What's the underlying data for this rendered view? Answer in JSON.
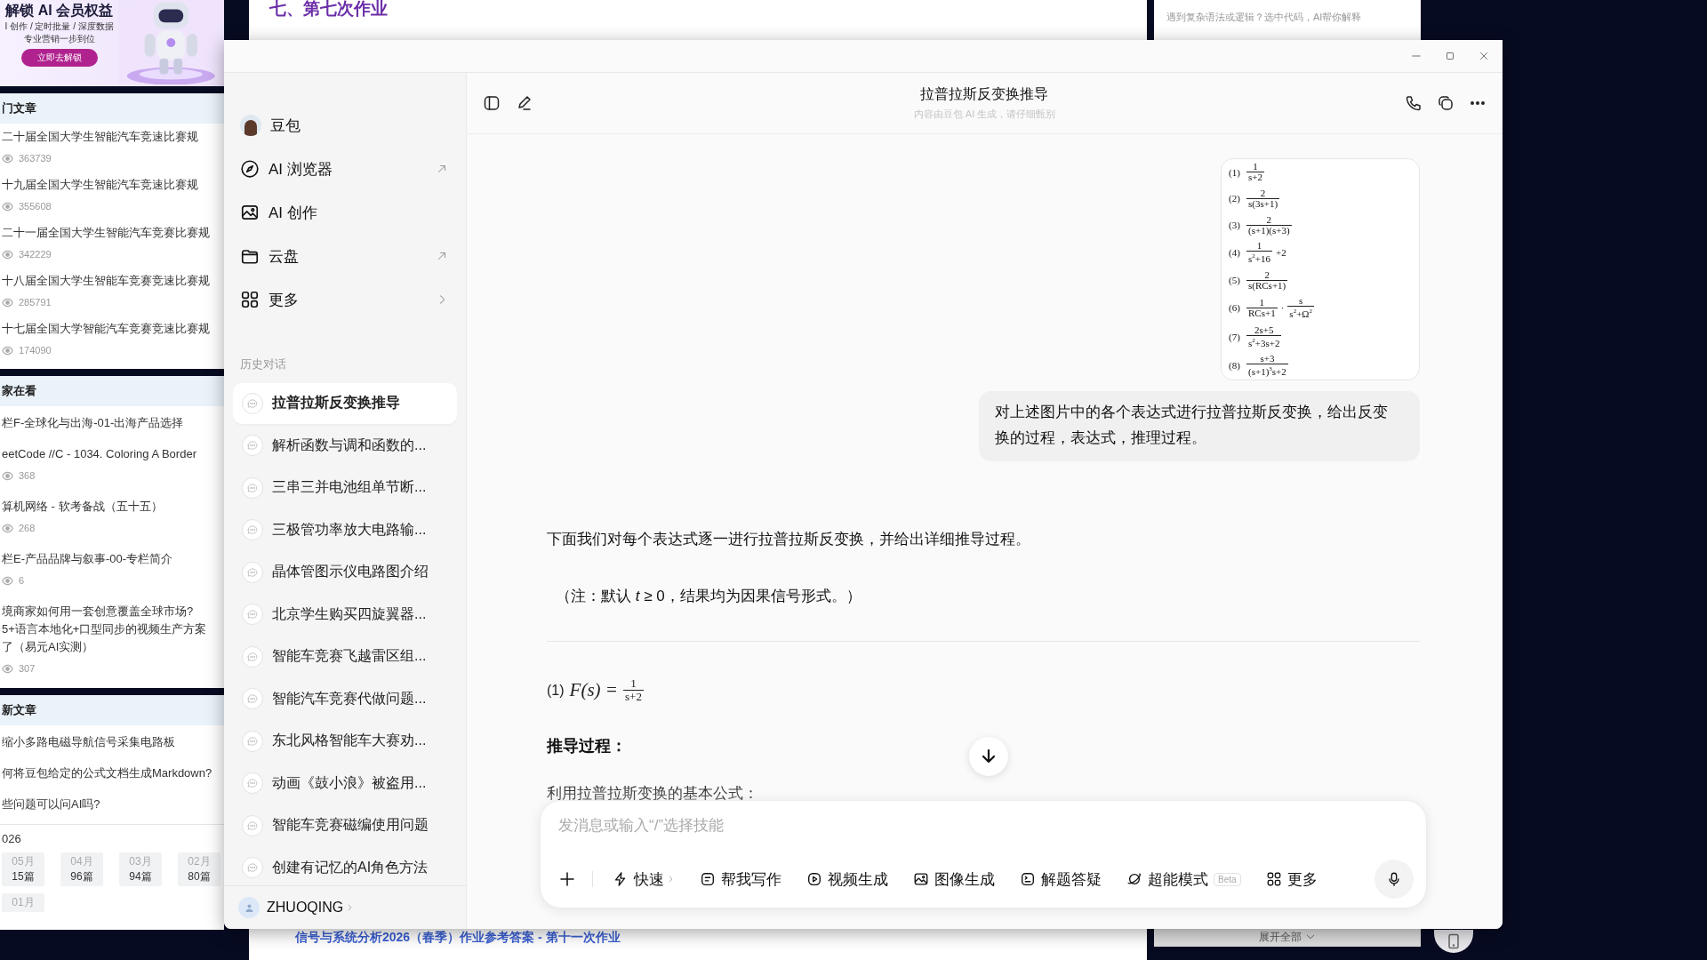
{
  "background_page": {
    "left_panel": {
      "banner": {
        "title": "解锁 AI 会员权益",
        "lines": [
          "I 创作 / 定时批量 / 深度数据",
          "专业营销一步到位"
        ],
        "button": "立即去解锁"
      },
      "sections": [
        {
          "title": "门文章",
          "items": [
            {
              "title": "二十届全国大学生智能汽车竞速比赛规",
              "views": "363739"
            },
            {
              "title": "十九届全国大学生智能汽车竞速比赛规",
              "views": "355608"
            },
            {
              "title": "二十一届全国大学生智能汽车竞赛比赛规",
              "views": "342229"
            },
            {
              "title": "十八届全国大学生智能车竞赛竞速比赛规",
              "views": "285791"
            },
            {
              "title": "十七届全国大学智能汽车竞赛竞速比赛规",
              "views": "174090"
            }
          ]
        },
        {
          "title": "家在看",
          "items": [
            {
              "title": "栏F-全球化与出海-01-出海产品选择"
            },
            {
              "title": "eetCode //C - 1034. Coloring A Border",
              "views": "368"
            },
            {
              "title": "算机网络 - 软考备战（五十五）",
              "views": "268"
            },
            {
              "title": "栏E-产品品牌与叙事-00-专栏简介",
              "views": "6"
            },
            {
              "title": "境商家如何用一套创意覆盖全球市场?5+语言本地化+口型同步的视频生产方案了（易元AI实测）",
              "views": "307"
            }
          ]
        },
        {
          "title": "新文章",
          "items": [
            {
              "title": "缩小多路电磁导航信号采集电路板"
            },
            {
              "title": "何将豆包给定的公式文档生成Markdown?"
            },
            {
              "title": "些问题可以问AI吗?"
            }
          ]
        }
      ],
      "archive": {
        "year": "026",
        "months": [
          {
            "month": "05月",
            "count": "15篇"
          },
          {
            "month": "04月",
            "count": "96篇"
          },
          {
            "month": "03月",
            "count": "94篇"
          },
          {
            "month": "02月",
            "count": "80篇"
          },
          {
            "month": "01月"
          }
        ]
      }
    },
    "center": {
      "heading": "七、第七次作业",
      "bottom_link": "信号与系统分析2026（春季）作业参考答案 - 第十一次作业"
    },
    "right_panel": {
      "tip": "遇到复杂语法或逻辑？选中代码，AI帮你解释",
      "expand": "展开全部"
    }
  },
  "window": {
    "sidebar": {
      "nav": [
        {
          "label": "豆包",
          "kind": "avatar"
        },
        {
          "label": "AI 浏览器",
          "kind": "external"
        },
        {
          "label": "AI 创作",
          "kind": "plain"
        },
        {
          "label": "云盘",
          "kind": "external"
        },
        {
          "label": "更多",
          "kind": "submenu"
        }
      ],
      "history_title": "历史对话",
      "history": [
        {
          "label": "拉普拉斯反变换推导",
          "selected": true
        },
        {
          "label": "解析函数与调和函数的...",
          "selected": false
        },
        {
          "label": "三串三并电池组单节断...",
          "selected": false
        },
        {
          "label": "三极管功率放大电路输...",
          "selected": false
        },
        {
          "label": "晶体管图示仪电路图介绍",
          "selected": false
        },
        {
          "label": "北京学生购买四旋翼器...",
          "selected": false
        },
        {
          "label": "智能车竞赛飞越雷区组...",
          "selected": false
        },
        {
          "label": "智能汽车竞赛代做问题...",
          "selected": false
        },
        {
          "label": "东北风格智能车大赛劝...",
          "selected": false
        },
        {
          "label": "动画《鼓小浪》被盗用...",
          "selected": false
        },
        {
          "label": "智能车竞赛磁编使用问题",
          "selected": false
        },
        {
          "label": "创建有记忆的AI角色方法",
          "selected": false
        }
      ],
      "user": "ZHUOQING"
    },
    "header": {
      "title": "拉普拉斯反变换推导",
      "subtitle": "内容由豆包 AI 生成，请仔细甄别"
    },
    "conversation": {
      "image": {
        "formulas": [
          {
            "label": "(1)",
            "parts": [
              {
                "kind": "frac",
                "num": "1",
                "den": "s+2"
              }
            ]
          },
          {
            "label": "(2)",
            "parts": [
              {
                "kind": "frac",
                "num": "2",
                "den": "s(3s+1)"
              }
            ]
          },
          {
            "label": "(3)",
            "parts": [
              {
                "kind": "frac",
                "num": "2",
                "den": "(s+1)(s+3)"
              }
            ]
          },
          {
            "label": "(4)",
            "parts": [
              {
                "kind": "frac",
                "num": "1",
                "den": "s$^{2}$+16"
              },
              {
                "kind": "text",
                "text": "+2"
              }
            ]
          },
          {
            "label": "(5)",
            "parts": [
              {
                "kind": "frac",
                "num": "2",
                "den": "s(RCs+1)"
              }
            ]
          },
          {
            "label": "(6)",
            "parts": [
              {
                "kind": "frac",
                "num": "1",
                "den": "RCs+1"
              },
              {
                "kind": "text",
                "text": "·"
              },
              {
                "kind": "frac",
                "num": "s",
                "den": "s$^{2}$+Ω$^{2}$"
              }
            ]
          },
          {
            "label": "(7)",
            "parts": [
              {
                "kind": "frac",
                "num": "2s+5",
                "den": "s$^{2}$+3s+2"
              }
            ]
          },
          {
            "label": "(8)",
            "parts": [
              {
                "kind": "frac",
                "num": "s+3",
                "den": "(s+1)$^{3}$s+2"
              }
            ]
          }
        ]
      },
      "user_message": "对上述图片中的各个表达式进行拉普拉斯反变换，给出反变换的过程，表达式，推理过程。",
      "reply": [
        {
          "kind": "paragraph",
          "text": "下面我们对每个表达式逐一进行拉普拉斯反变换，并给出详细推导过程。"
        },
        {
          "kind": "note",
          "text": "（注：默认 *t* ≥ 0，结果均为因果信号形式。）"
        },
        {
          "kind": "divider"
        },
        {
          "kind": "formula",
          "label": "(1)",
          "lhs": "F(s) =",
          "num": "1",
          "den": "s+2"
        },
        {
          "kind": "heading",
          "text": "推导过程："
        },
        {
          "kind": "paragraph",
          "text": "利用拉普拉斯变换的基本公式："
        }
      ]
    },
    "composer": {
      "placeholder": "发消息或输入“/”选择技能",
      "tools": [
        {
          "label": "快速",
          "kind": "dropdown"
        },
        {
          "label": "帮我写作",
          "kind": "skill"
        },
        {
          "label": "视频生成",
          "kind": "skill"
        },
        {
          "label": "图像生成",
          "kind": "skill"
        },
        {
          "label": "解题答疑",
          "kind": "skill"
        },
        {
          "label": "超能模式",
          "kind": "skill",
          "badge": "Beta"
        },
        {
          "label": "更多",
          "kind": "skill"
        }
      ]
    }
  }
}
